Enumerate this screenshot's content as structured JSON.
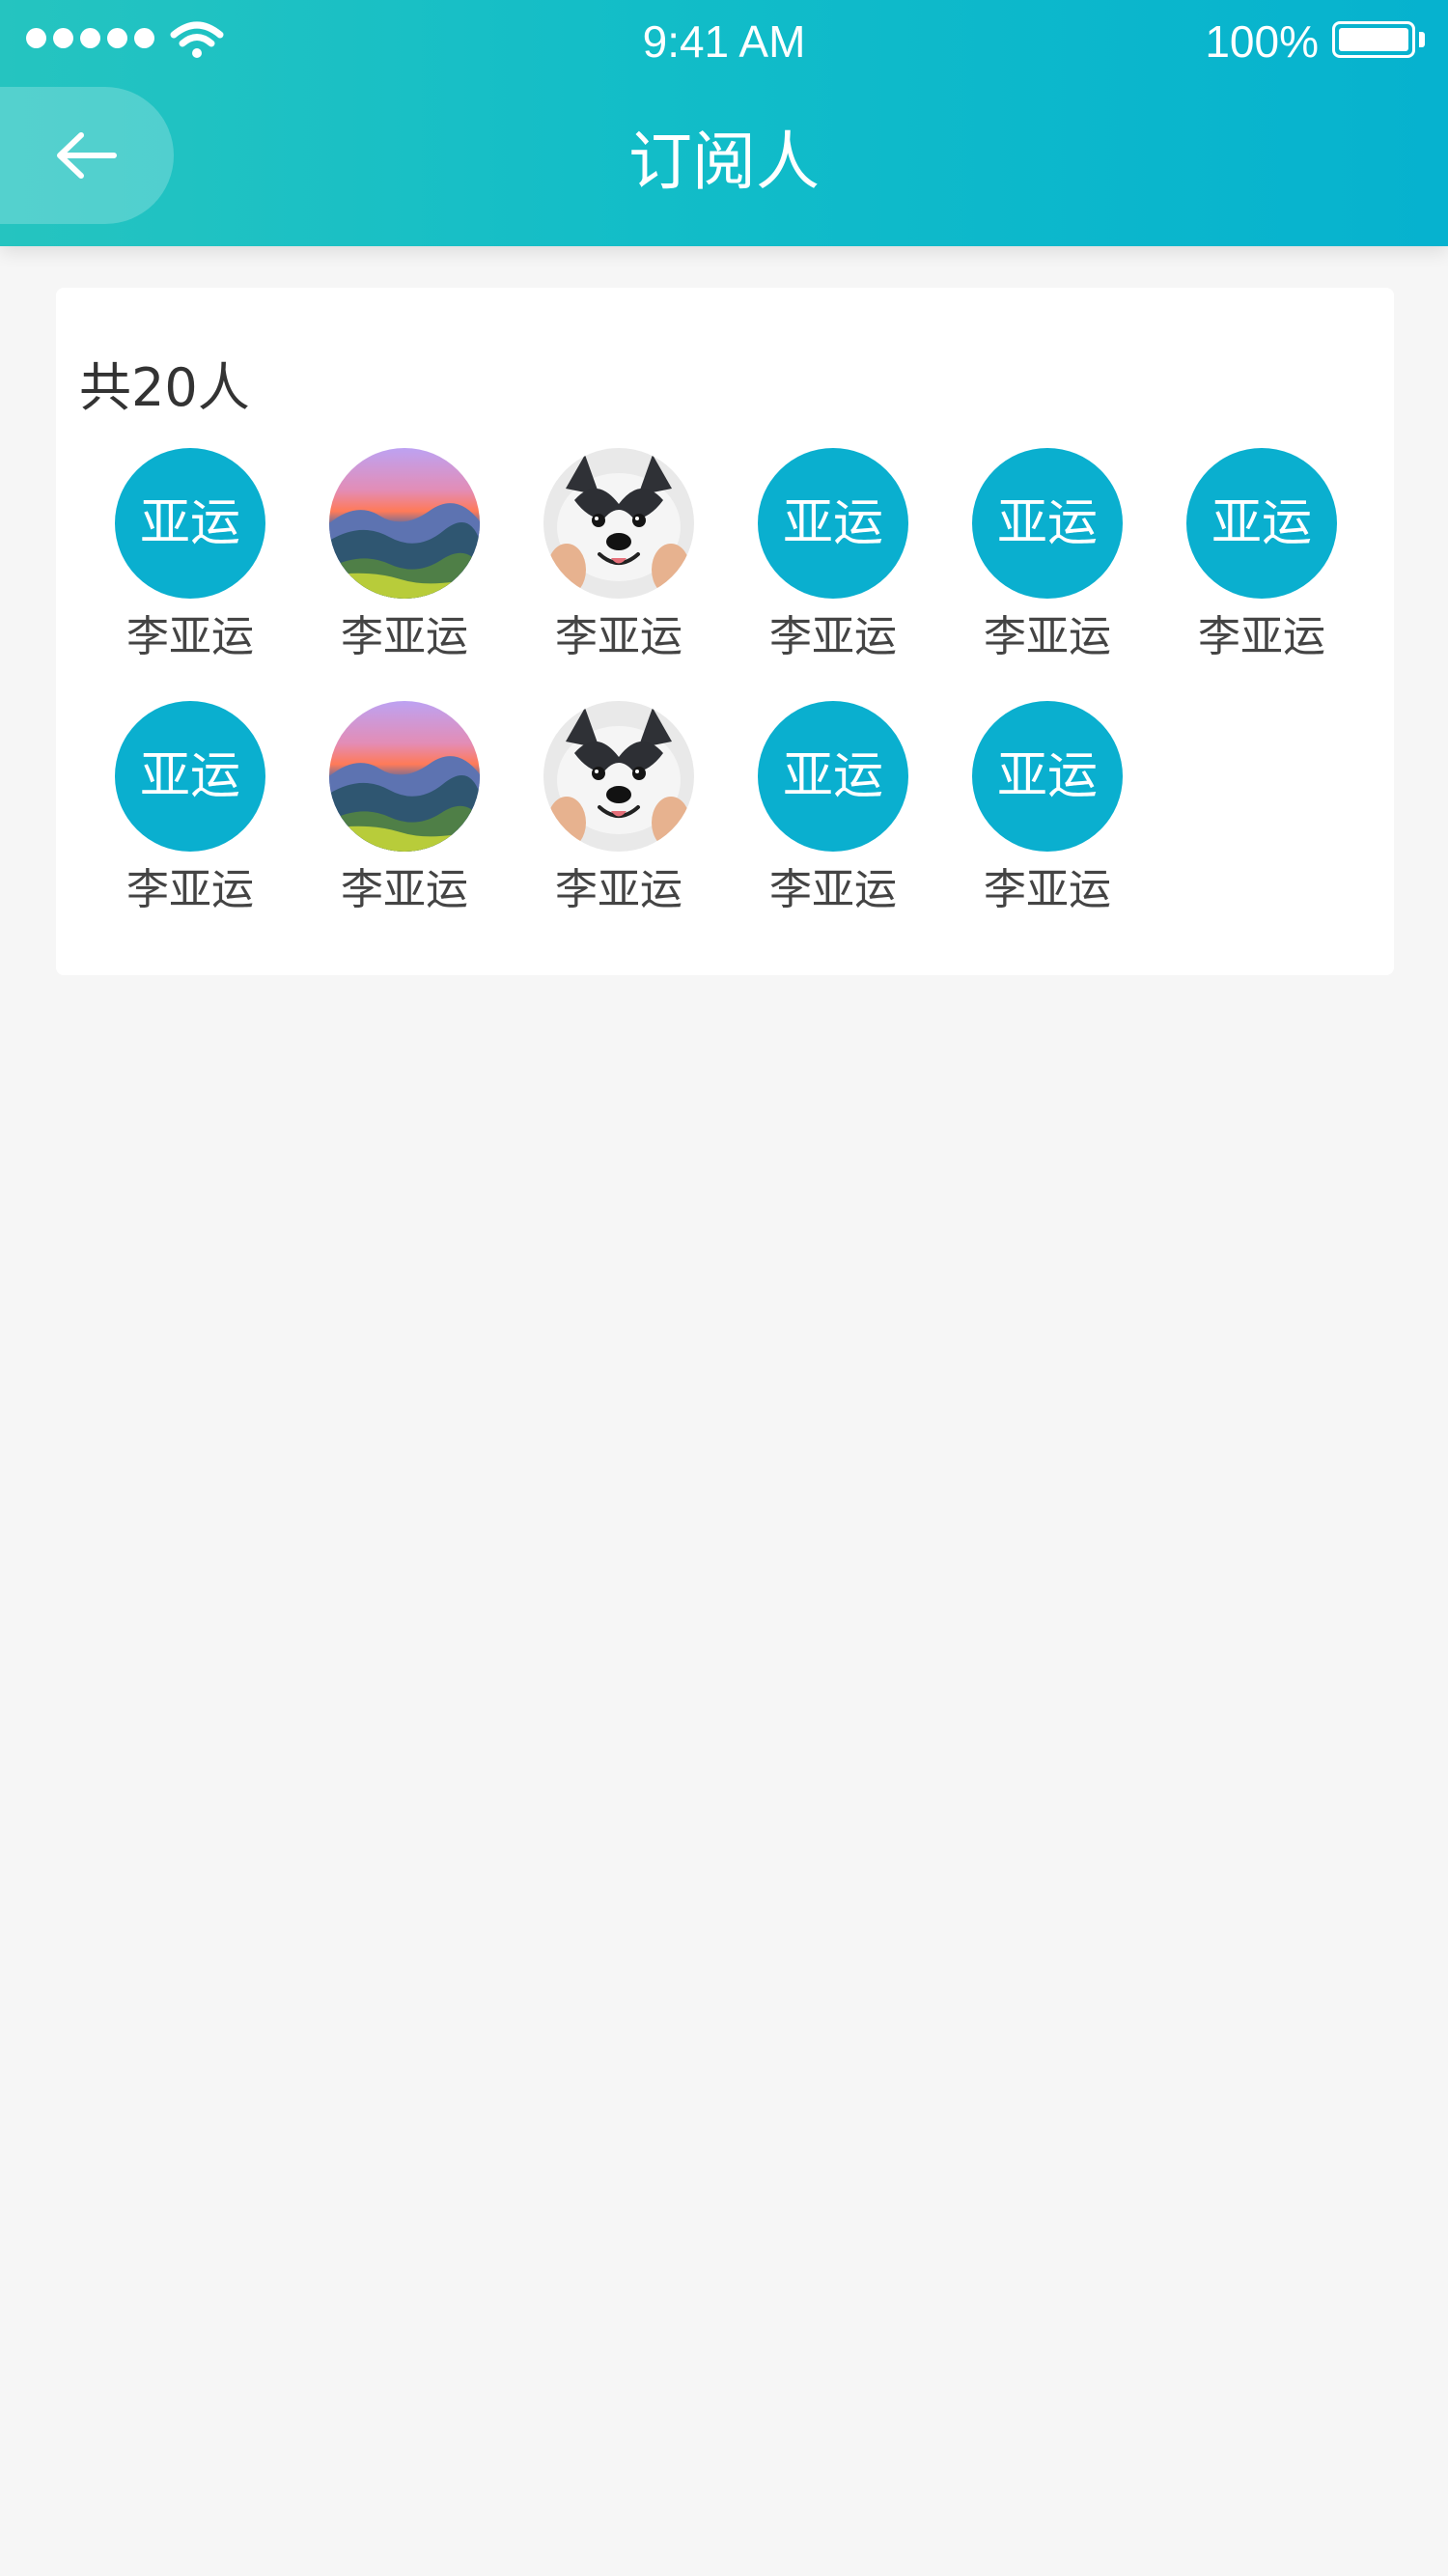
{
  "status_bar": {
    "time": "9:41 AM",
    "battery": "100%"
  },
  "header": {
    "title": "订阅人"
  },
  "summary": {
    "total": "共20人"
  },
  "subscribers": [
    {
      "avatar_type": "initials",
      "avatar_text": "亚运",
      "name": "李亚运"
    },
    {
      "avatar_type": "landscape",
      "avatar_text": "",
      "name": "李亚运"
    },
    {
      "avatar_type": "dog",
      "avatar_text": "",
      "name": "李亚运"
    },
    {
      "avatar_type": "initials",
      "avatar_text": "亚运",
      "name": "李亚运"
    },
    {
      "avatar_type": "initials",
      "avatar_text": "亚运",
      "name": "李亚运"
    },
    {
      "avatar_type": "initials",
      "avatar_text": "亚运",
      "name": "李亚运"
    },
    {
      "avatar_type": "initials",
      "avatar_text": "亚运",
      "name": "李亚运"
    },
    {
      "avatar_type": "landscape",
      "avatar_text": "",
      "name": "李亚运"
    },
    {
      "avatar_type": "dog",
      "avatar_text": "",
      "name": "李亚运"
    },
    {
      "avatar_type": "initials",
      "avatar_text": "亚运",
      "name": "李亚运"
    },
    {
      "avatar_type": "initials",
      "avatar_text": "亚运",
      "name": "李亚运"
    }
  ],
  "colors": {
    "header_gradient_start": "#25c4c0",
    "header_gradient_end": "#06b2cf",
    "avatar_accent": "#0aafcf",
    "page_background": "#f6f6f6"
  },
  "icons": {
    "back": "arrow-left-icon",
    "wifi": "wifi-icon",
    "battery": "battery-icon",
    "signal": "signal-icon"
  }
}
